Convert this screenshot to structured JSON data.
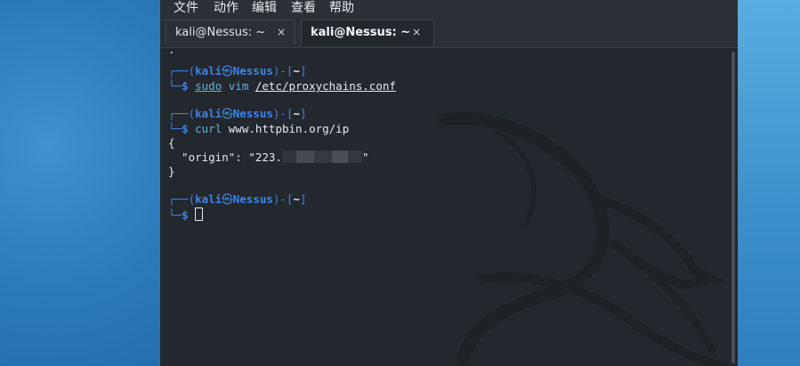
{
  "menu": {
    "items": [
      "文件",
      "动作",
      "编辑",
      "查看",
      "帮助"
    ]
  },
  "tabs": [
    {
      "label": "kali@Nessus: ~",
      "close": "×",
      "active": false
    },
    {
      "label": "kali@Nessus: ~",
      "close": "×",
      "active": true
    }
  ],
  "terminal": {
    "prompt_user": "kali",
    "prompt_skull": "㉿",
    "prompt_host": "Nessus",
    "prompt_dir": "~",
    "prompt_symbol": "$",
    "blocks": [
      {
        "cmd": "sudo",
        "args": "vim",
        "path": "/etc/proxychains.conf"
      },
      {
        "cmd": "curl",
        "args": "www.httpbin.org/ip"
      }
    ],
    "output": {
      "open_brace": "{",
      "origin_line": "  \"origin\": \"223.",
      "origin_tail": "\"",
      "close_brace": "}"
    }
  },
  "colors": {
    "accent": "#3d84e5",
    "command": "#5fb3d9",
    "terminal_bg": "#23272e",
    "desktop": "#2a78b8"
  },
  "icons": {
    "tab_close": "close-icon",
    "background": "kali-dragon-icon"
  }
}
